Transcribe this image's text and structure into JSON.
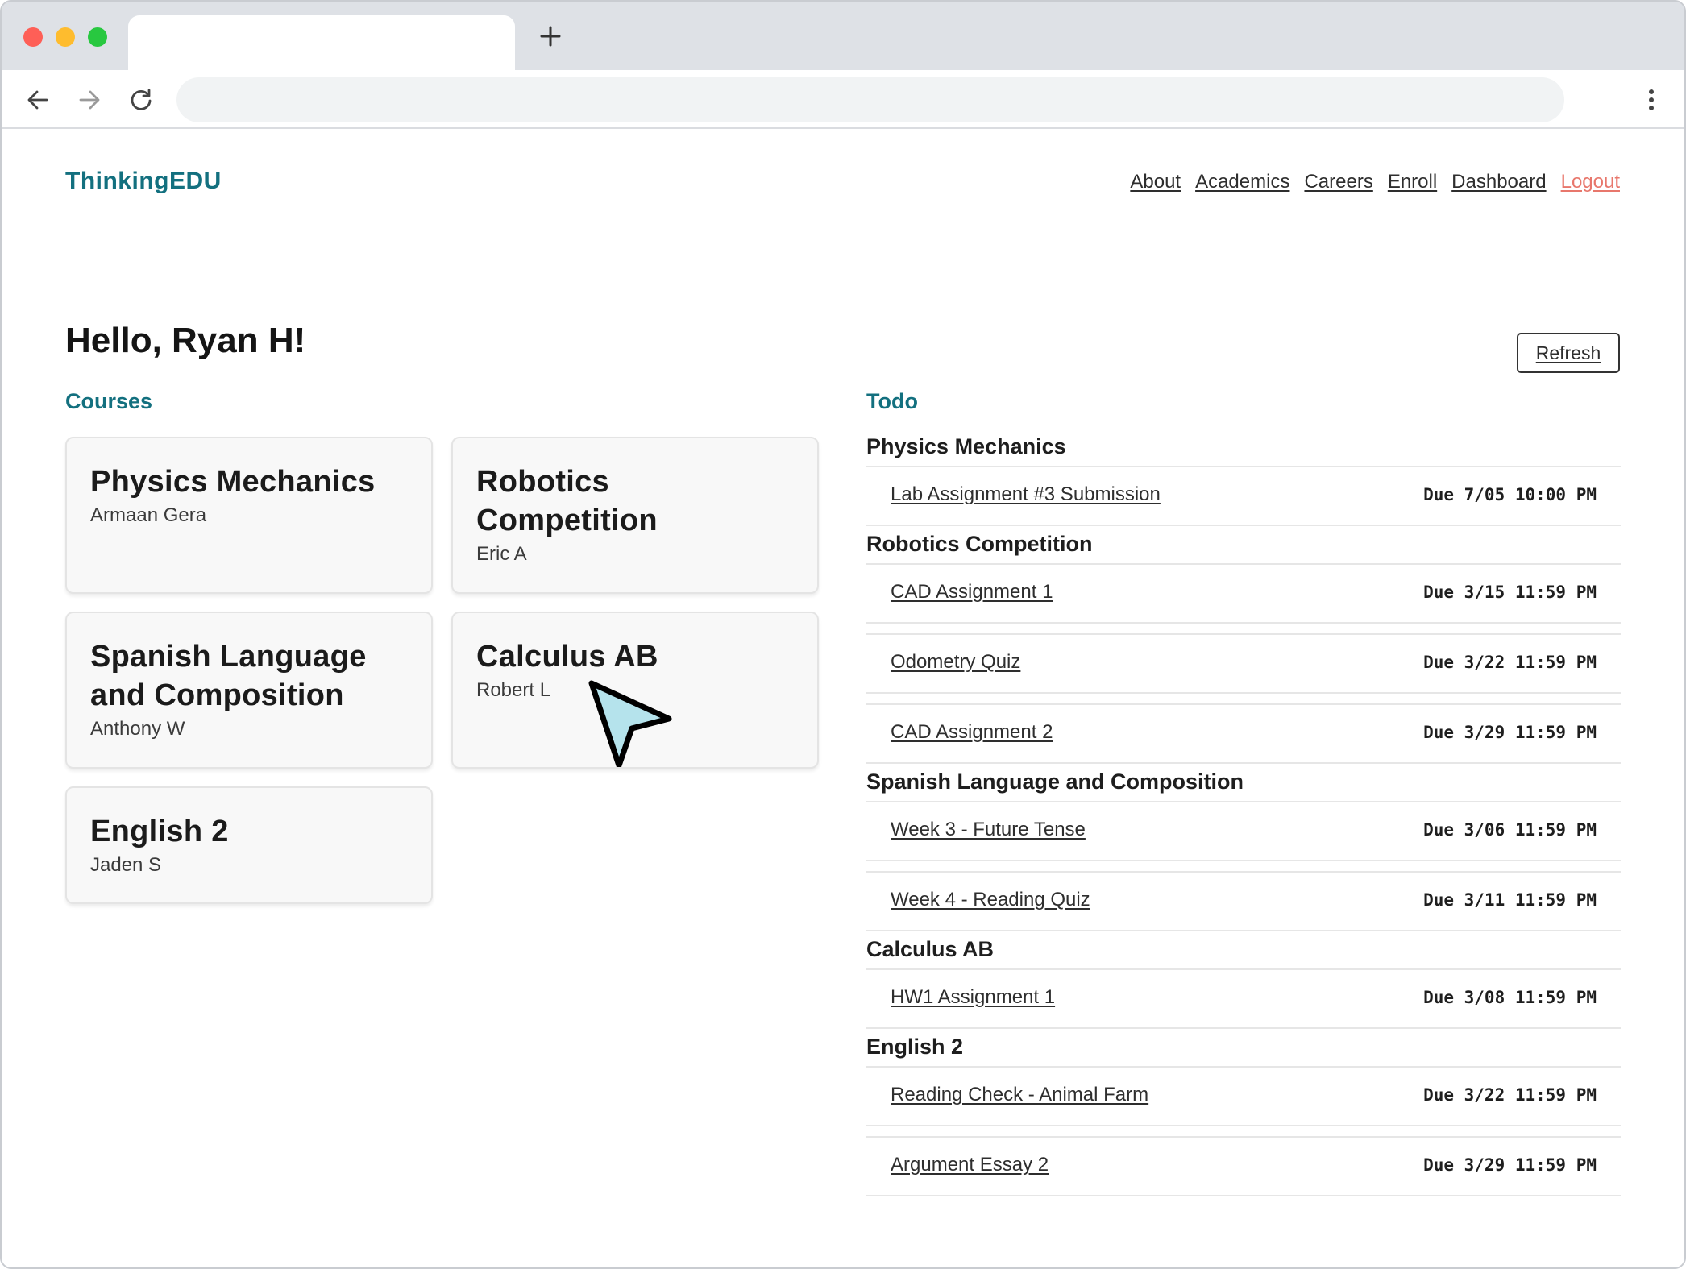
{
  "site": {
    "brand": "ThinkingEDU",
    "nav": [
      {
        "label": "About"
      },
      {
        "label": "Academics"
      },
      {
        "label": "Careers"
      },
      {
        "label": "Enroll"
      },
      {
        "label": "Dashboard"
      },
      {
        "label": "Logout"
      }
    ]
  },
  "dashboard": {
    "greeting": "Hello, Ryan H!",
    "refresh_label": "Refresh",
    "courses_title": "Courses",
    "todo_title": "Todo"
  },
  "courses": [
    {
      "title": "Physics Mechanics",
      "instructor": "Armaan Gera"
    },
    {
      "title": "Robotics Competition",
      "instructor": "Eric A"
    },
    {
      "title": "Spanish Language and Composition",
      "instructor": "Anthony W"
    },
    {
      "title": "Calculus AB",
      "instructor": "Robert L"
    },
    {
      "title": "English 2",
      "instructor": "Jaden S"
    }
  ],
  "todo": [
    {
      "course": "Physics Mechanics",
      "items": [
        {
          "name": "Lab Assignment #3 Submission",
          "due": "Due 7/05 10:00 PM"
        }
      ]
    },
    {
      "course": "Robotics Competition",
      "items": [
        {
          "name": "CAD Assignment 1",
          "due": "Due 3/15 11:59 PM"
        },
        {
          "name": "Odometry Quiz",
          "due": "Due 3/22 11:59 PM"
        },
        {
          "name": "CAD Assignment 2",
          "due": "Due 3/29 11:59 PM"
        }
      ]
    },
    {
      "course": "Spanish Language and Composition",
      "items": [
        {
          "name": "Week 3 - Future Tense",
          "due": "Due 3/06 11:59 PM"
        },
        {
          "name": "Week 4 - Reading Quiz",
          "due": "Due 3/11 11:59 PM"
        }
      ]
    },
    {
      "course": "Calculus AB",
      "items": [
        {
          "name": "HW1 Assignment 1",
          "due": "Due 3/08 11:59 PM"
        }
      ]
    },
    {
      "course": "English 2",
      "items": [
        {
          "name": "Reading Check - Animal Farm",
          "due": "Due 3/22 11:59 PM"
        },
        {
          "name": "Argument Essay 2",
          "due": "Due 3/29 11:59 PM"
        }
      ]
    }
  ],
  "icons": {
    "back": "arrow-left-icon",
    "forward": "arrow-right-icon",
    "reload": "reload-icon",
    "new_tab": "plus-icon",
    "menu": "kebab-menu-icon",
    "cursor": "mouse-pointer-icon"
  },
  "colors": {
    "brand": "#13707f",
    "logout": "#e8776c",
    "cursor_fill": "#b5e3ec"
  }
}
